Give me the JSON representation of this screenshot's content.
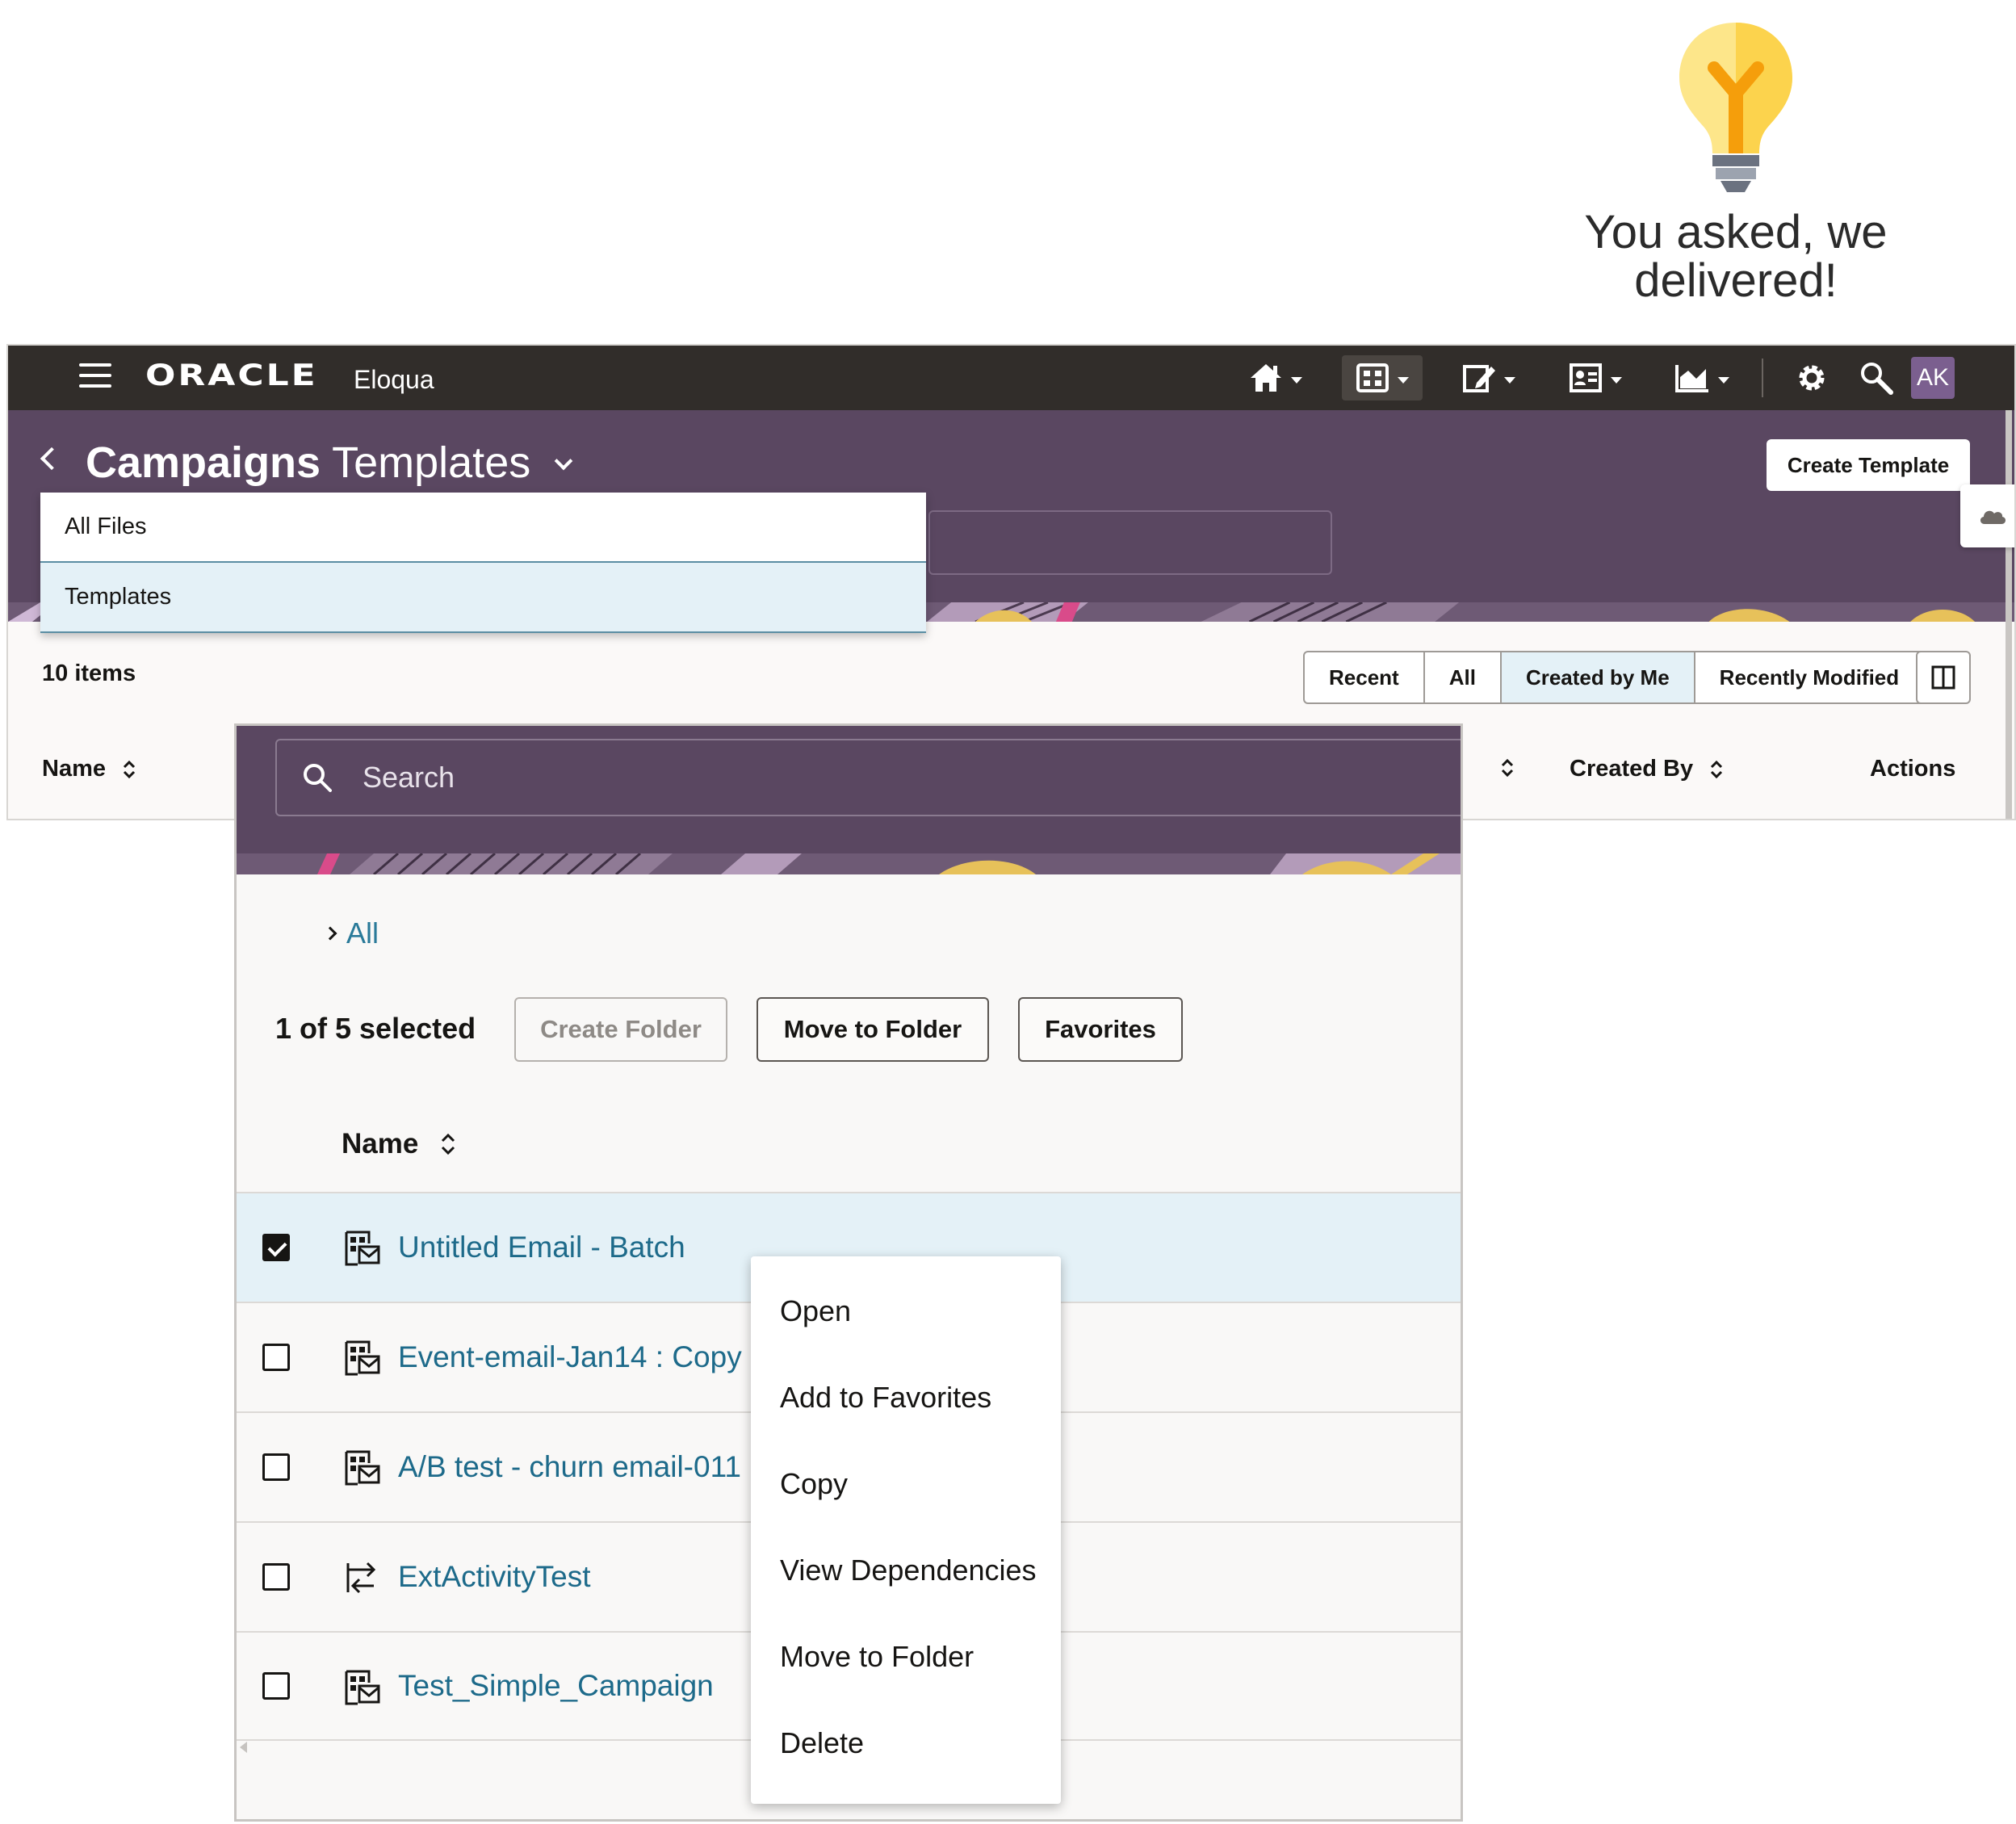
{
  "tip": {
    "line1": "You asked, we",
    "line2": "delivered!"
  },
  "topbar": {
    "brand": "ORACLE",
    "product": "Eloqua",
    "avatar_initials": "AK",
    "nav_icons": [
      "home-icon",
      "campaign-canvas-icon",
      "edit-assets-icon",
      "contacts-icon",
      "analytics-icon",
      "gear-icon",
      "search-icon"
    ]
  },
  "header": {
    "title_bold": "Campaigns",
    "title_rest": "Templates",
    "create_button": "Create Template"
  },
  "dropdown": {
    "items": [
      "All Files",
      "Templates"
    ],
    "highlighted": "Templates"
  },
  "list": {
    "count": "10 items",
    "filters": [
      "Recent",
      "All",
      "Created by Me",
      "Recently Modified"
    ],
    "selected_filter": "Created by Me",
    "columns": {
      "name": "Name",
      "created_by": "Created By",
      "actions": "Actions"
    }
  },
  "panel": {
    "search_placeholder": "Search",
    "breadcrumb": "All",
    "selected_count": "1 of 5 selected",
    "buttons": {
      "create_folder": "Create Folder",
      "move_to_folder": "Move to Folder",
      "favorites": "Favorites"
    },
    "name_column": "Name",
    "rows": [
      {
        "name": "Untitled Email - Batch",
        "checked": true,
        "icon": "email-campaign-icon"
      },
      {
        "name": "Event-email-Jan14 : Copy -",
        "checked": false,
        "icon": "email-campaign-icon"
      },
      {
        "name": "A/B test - churn email-011",
        "checked": false,
        "icon": "email-campaign-icon"
      },
      {
        "name": "ExtActivityTest",
        "checked": false,
        "icon": "external-activity-icon"
      },
      {
        "name": "Test_Simple_Campaign",
        "checked": false,
        "icon": "email-campaign-icon"
      }
    ]
  },
  "context_menu": {
    "items": [
      "Open",
      "Add to Favorites",
      "Copy",
      "View Dependencies",
      "Move to Folder",
      "Delete"
    ]
  },
  "colors": {
    "header_purple": "#5a4761",
    "topbar": "#312d2a",
    "link": "#1d6a8a",
    "selection": "#e4f1f7",
    "bulb_yellow": "#fcd34d",
    "bulb_orange": "#f59e0b"
  }
}
